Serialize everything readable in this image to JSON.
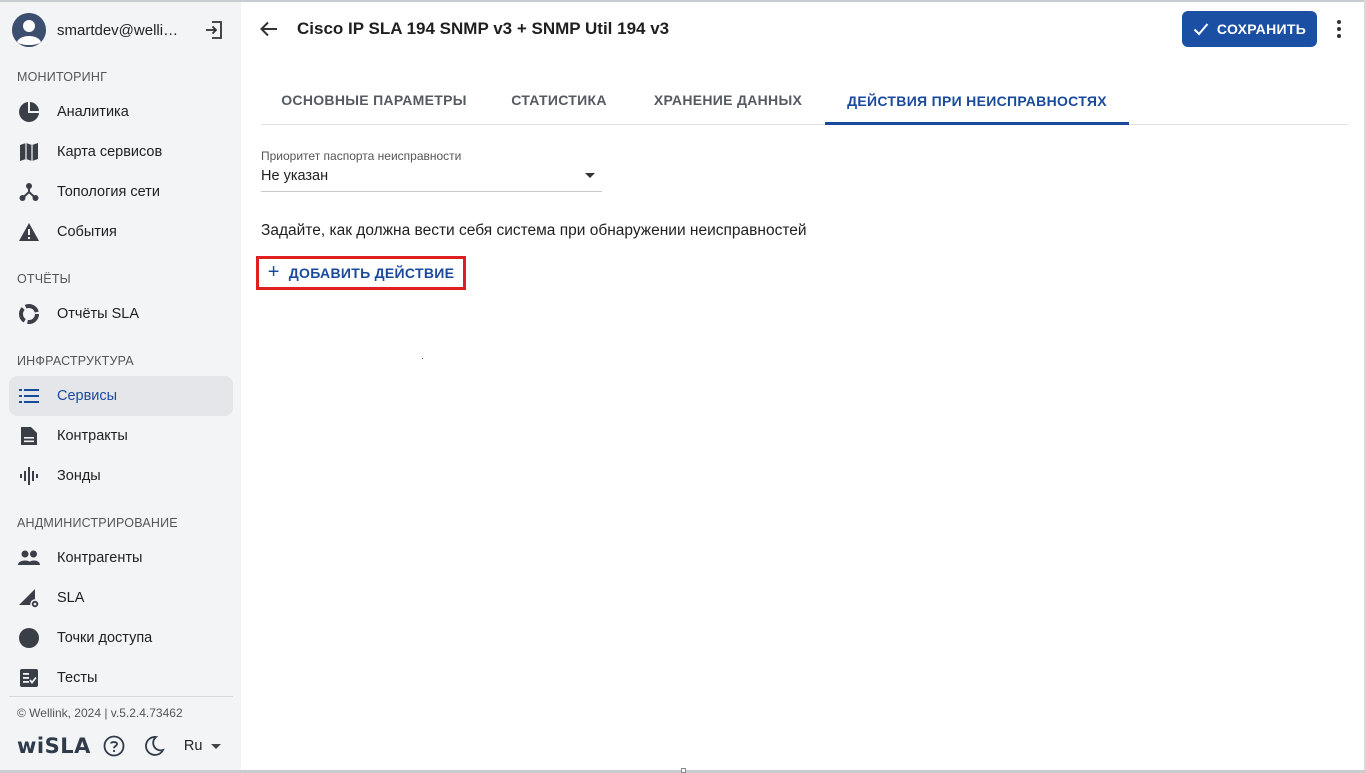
{
  "user": {
    "email": "smartdev@wellin..."
  },
  "sidebar": {
    "sections": [
      {
        "title": "МОНИТОРИНГ",
        "items": [
          {
            "label": "Аналитика",
            "icon": "pie-chart-icon"
          },
          {
            "label": "Карта сервисов",
            "icon": "map-icon"
          },
          {
            "label": "Топология сети",
            "icon": "topology-icon"
          },
          {
            "label": "События",
            "icon": "warning-icon"
          }
        ]
      },
      {
        "title": "ОТЧЁТЫ",
        "items": [
          {
            "label": "Отчёты SLA",
            "icon": "donut-icon"
          }
        ]
      },
      {
        "title": "ИНФРАСТРУКТУРА",
        "items": [
          {
            "label": "Сервисы",
            "icon": "list-icon",
            "active": true
          },
          {
            "label": "Контракты",
            "icon": "document-icon"
          },
          {
            "label": "Зонды",
            "icon": "waveform-icon"
          }
        ]
      },
      {
        "title": "АНДМИНИСТРИРОВАНИЕ",
        "items": [
          {
            "label": "Контрагенты",
            "icon": "people-icon"
          },
          {
            "label": "SLA",
            "icon": "sla-settings-icon"
          },
          {
            "label": "Точки доступа",
            "icon": "circle-icon"
          },
          {
            "label": "Тесты",
            "icon": "checklist-icon"
          }
        ]
      }
    ],
    "copyright": "© Wellink, 2024 | v.5.2.4.73462",
    "logo": "wiSLA",
    "language": "Ru"
  },
  "header": {
    "title": "Cisco IP SLA 194 SNMP v3 + SNMP Util 194 v3",
    "save_label": "СОХРАНИТЬ"
  },
  "tabs": [
    {
      "label": "ОСНОВНЫЕ ПАРАМЕТРЫ"
    },
    {
      "label": "СТАТИСТИКА"
    },
    {
      "label": "ХРАНЕНИЕ ДАННЫХ"
    },
    {
      "label": "ДЕЙСТВИЯ ПРИ НЕИСПРАВНОСТЯХ",
      "active": true
    }
  ],
  "content": {
    "priority_label": "Приоритет паспорта неисправности",
    "priority_value": "Не указан",
    "description": "Задайте, как должна вести себя система при обнаружении неисправностей",
    "add_action_label": "ДОБАВИТЬ ДЕЙСТВИЕ"
  },
  "colors": {
    "accent": "#1a4fa3",
    "active_text": "#1a4a9c",
    "sidebar_bg": "#f3f4f6",
    "highlight_border": "#e02020"
  }
}
